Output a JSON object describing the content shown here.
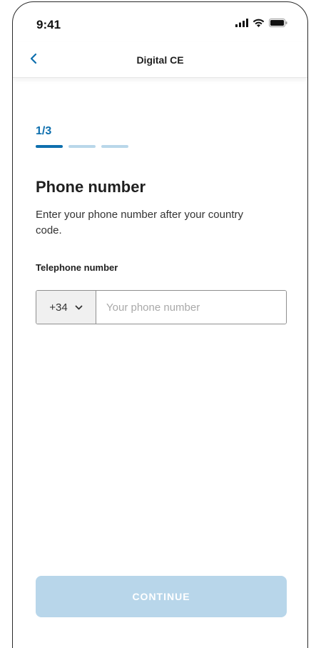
{
  "status_bar": {
    "time": "9:41",
    "icons": [
      "signal-icon",
      "wifi-icon",
      "battery-icon"
    ]
  },
  "nav": {
    "title": "Digital CE",
    "back_icon": "chevron-left-icon"
  },
  "progress": {
    "label": "1/3",
    "current_step": 1,
    "total_steps": 3
  },
  "content": {
    "title": "Phone number",
    "description": "Enter your phone number after your country code."
  },
  "form": {
    "field_label": "Telephone number",
    "country_code": "+34",
    "country_icon": "chevron-down-icon",
    "phone_value": "",
    "phone_placeholder": "Your phone number"
  },
  "actions": {
    "continue_label": "CONTINUE"
  },
  "colors": {
    "accent": "#0e6fae",
    "accent_light": "#b9d7ea",
    "button_disabled": "#b8d6ea"
  }
}
